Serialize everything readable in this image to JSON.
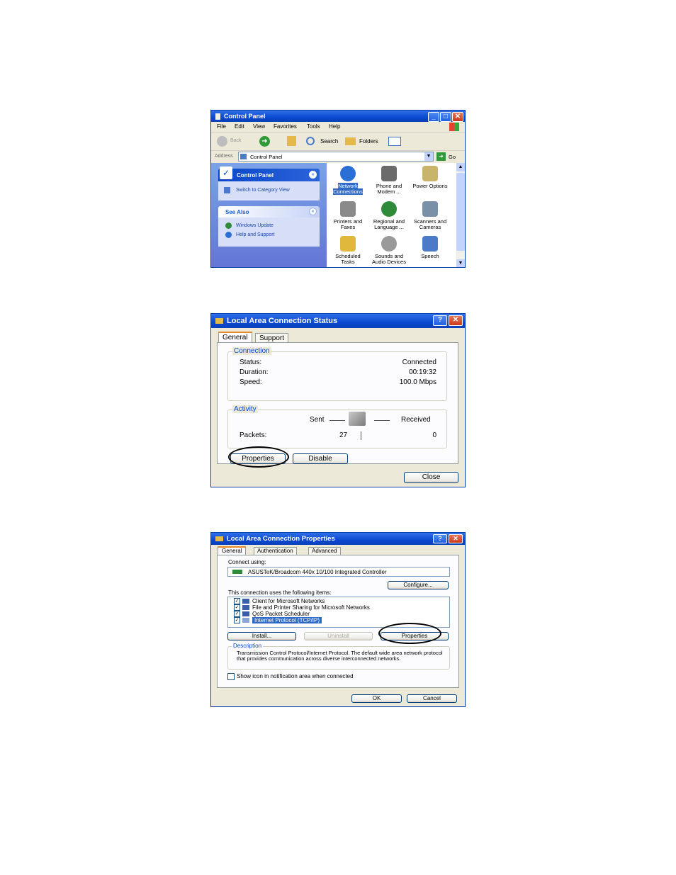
{
  "control_panel": {
    "title": "Control Panel",
    "menu": [
      "File",
      "Edit",
      "View",
      "Favorites",
      "Tools",
      "Help"
    ],
    "toolbar": {
      "back": "Back",
      "search": "Search",
      "folders": "Folders"
    },
    "address_label": "Address",
    "address_value": "Control Panel",
    "go_label": "Go",
    "task_pane": {
      "header": "Control Panel",
      "switch_link": "Switch to Category View",
      "see_also": "See Also",
      "links": [
        "Windows Update",
        "Help and Support"
      ]
    },
    "icons": [
      {
        "line1": "Network",
        "line2": "Connections",
        "color": "#2a6fd6"
      },
      {
        "line1": "Phone and",
        "line2": "Modem ...",
        "color": "#6b6b6b"
      },
      {
        "line1": "Power Options",
        "line2": "",
        "color": "#c8b46a"
      },
      {
        "line1": "Printers and",
        "line2": "Faxes",
        "color": "#8a8a8a"
      },
      {
        "line1": "Regional and",
        "line2": "Language ...",
        "color": "#2f8a3a"
      },
      {
        "line1": "Scanners and",
        "line2": "Cameras",
        "color": "#7a8fa8"
      },
      {
        "line1": "Scheduled",
        "line2": "Tasks",
        "color": "#e0b93c"
      },
      {
        "line1": "Sounds and",
        "line2": "Audio Devices",
        "color": "#9a9a9a"
      },
      {
        "line1": "Speech",
        "line2": "",
        "color": "#4a7ac8"
      }
    ]
  },
  "status_dialog": {
    "title": "Local Area Connection Status",
    "tabs": [
      "General",
      "Support"
    ],
    "connection_legend": "Connection",
    "rows": [
      {
        "label": "Status:",
        "value": "Connected"
      },
      {
        "label": "Duration:",
        "value": "00:19:32"
      },
      {
        "label": "Speed:",
        "value": "100.0 Mbps"
      }
    ],
    "activity_legend": "Activity",
    "sent_label": "Sent",
    "received_label": "Received",
    "packets_label": "Packets:",
    "packets_sent": "27",
    "packets_received": "0",
    "properties_button": "Properties",
    "disable_button": "Disable",
    "close_button": "Close"
  },
  "properties_dialog": {
    "title": "Local Area Connection Properties",
    "tabs": [
      "General",
      "Authentication",
      "Advanced"
    ],
    "connect_using_label": "Connect using:",
    "adapter": "ASUSTeK/Broadcom 440x 10/100 Integrated Controller",
    "configure_button": "Configure...",
    "items_label": "This connection uses the following items:",
    "items": [
      "Client for Microsoft Networks",
      "File and Printer Sharing for Microsoft Networks",
      "QoS Packet Scheduler",
      "Internet Protocol (TCP/IP)"
    ],
    "install_button": "Install...",
    "uninstall_button": "Uninstall",
    "properties_button": "Properties",
    "description_legend": "Description",
    "description_text": "Transmission Control Protocol/Internet Protocol. The default wide area network protocol that provides communication across diverse interconnected networks.",
    "show_icon_label": "Show icon in notification area when connected",
    "ok_button": "OK",
    "cancel_button": "Cancel"
  }
}
